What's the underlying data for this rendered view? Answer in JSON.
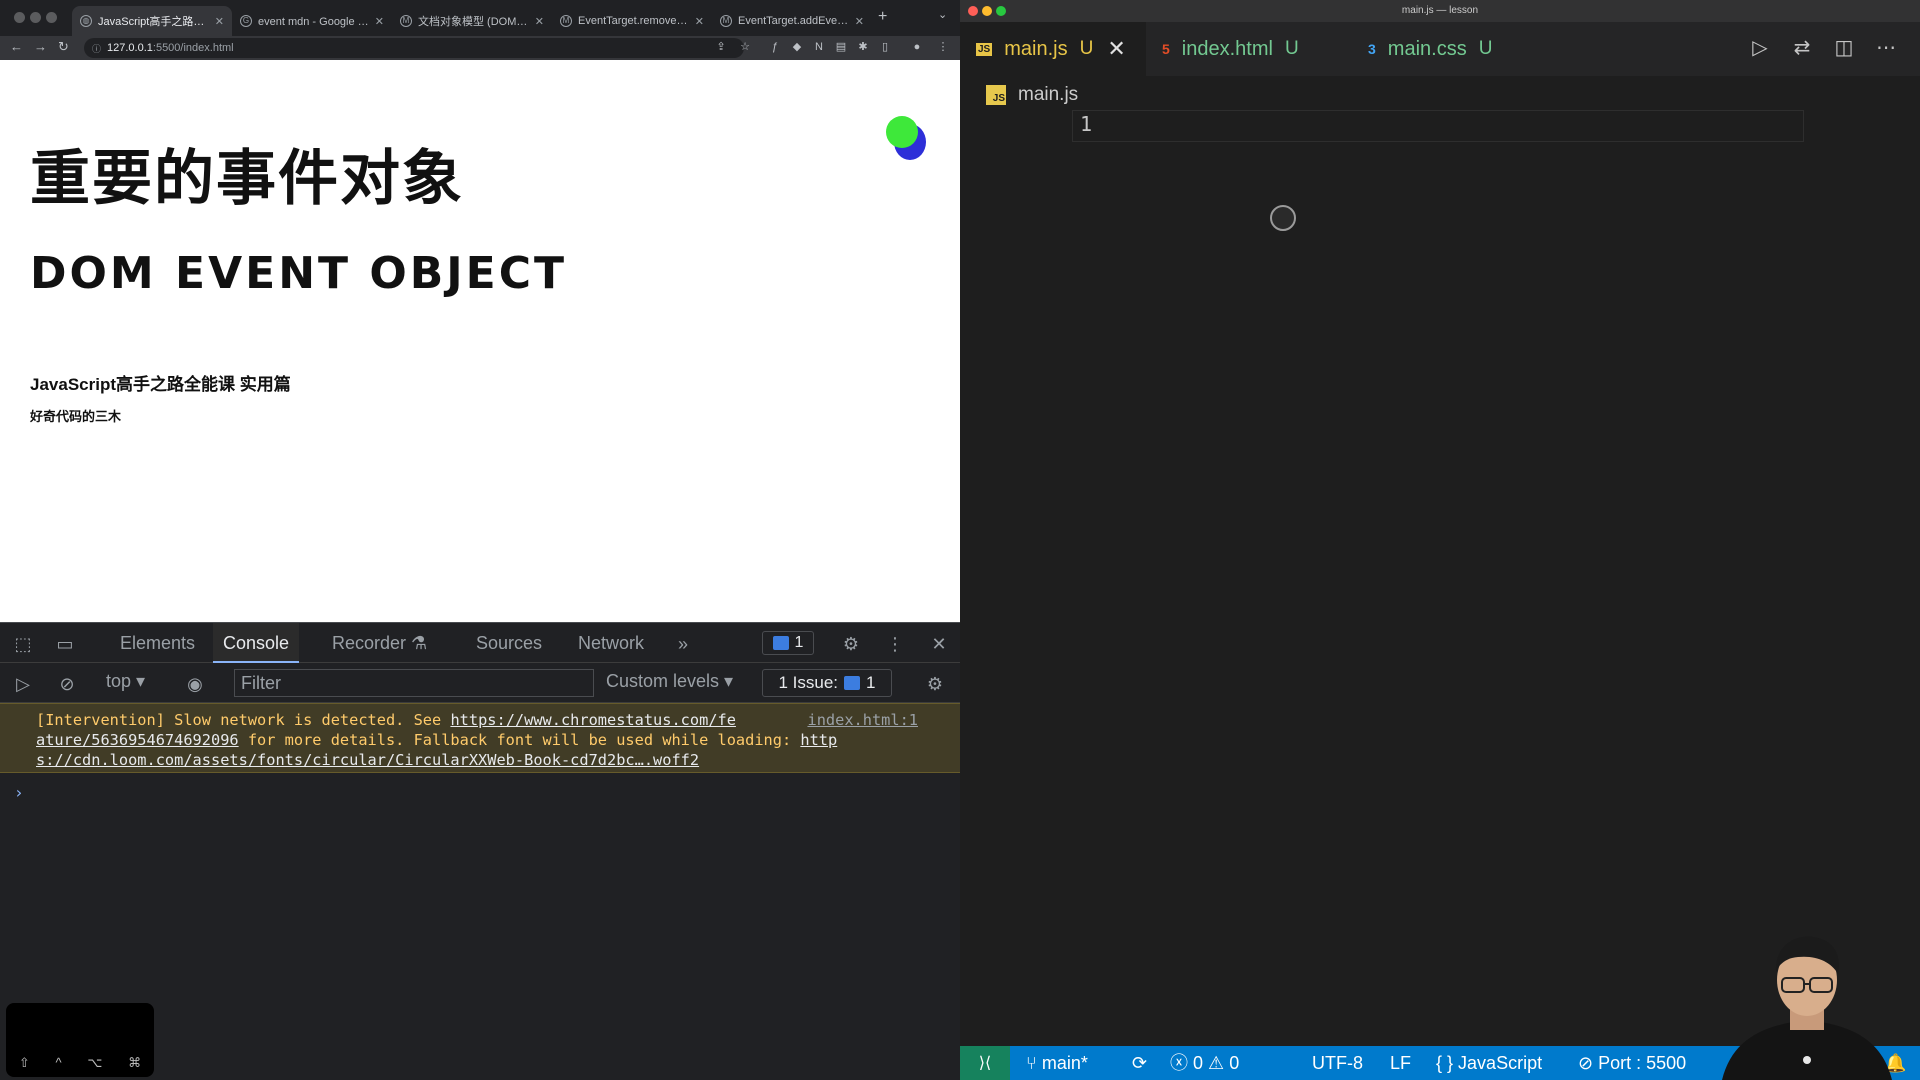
{
  "browser": {
    "tabs": [
      {
        "label": "JavaScript高手之路全能课",
        "favicon": "globe-icon",
        "active": true
      },
      {
        "label": "event mdn - Google 搜索",
        "favicon": "google-icon",
        "active": false
      },
      {
        "label": "文档对象模型 (DOM) - Web",
        "favicon": "mdn-icon",
        "active": false
      },
      {
        "label": "EventTarget.removeEventL",
        "favicon": "mdn-icon",
        "active": false
      },
      {
        "label": "EventTarget.addEventListe",
        "favicon": "mdn-icon",
        "active": false
      }
    ],
    "url_host": "127.0.0.1",
    "url_path": ":5500/index.html",
    "page": {
      "heading_cn": "重要的事件对象",
      "heading_en": "DOM EVENT OBJECT",
      "course_title": "JavaScript高手之路全能课 实用篇",
      "author": "好奇代码的三木"
    }
  },
  "devtools": {
    "tabs": [
      "Elements",
      "Console",
      "Recorder",
      "Sources",
      "Network"
    ],
    "active_tab": "Console",
    "message_count": "1",
    "context": "top",
    "filter_placeholder": "Filter",
    "levels": "Custom levels",
    "issues_label": "1 Issue:",
    "issues_count": "1",
    "warning": {
      "pre": "[Intervention] Slow network is detected. See ",
      "link1a": "https://www.chromestatus.com/fe",
      "link1b": "ature/5636954674692096",
      "mid": " for more details. Fallback font will be used while loading: ",
      "link2a": "http",
      "link2b": "s://cdn.loom.com/assets/fonts/circular/CircularXXWeb-Book-cd7d2bc….woff2",
      "source": "index.html:1"
    },
    "prompt": "›"
  },
  "key_overlay": {
    "keys": [
      "⇧",
      "^",
      "⌥",
      "⌘"
    ]
  },
  "vscode": {
    "window_title": "main.js — lesson",
    "tabs": [
      {
        "label": "main.js",
        "modified": "U",
        "icon": "JS",
        "color": "#e8c547",
        "active": true
      },
      {
        "label": "index.html",
        "modified": "U",
        "icon": "5",
        "color": "#e44d26",
        "active": false
      },
      {
        "label": "main.css",
        "modified": "U",
        "icon": "3",
        "color": "#42a5f5",
        "active": false
      }
    ],
    "breadcrumb": "main.js",
    "line_number": "1",
    "status": {
      "branch": "main*",
      "errors": "0",
      "warnings": "0",
      "encoding": "UTF-8",
      "eol": "LF",
      "language": "JavaScript",
      "port": "Port : 5500"
    }
  }
}
